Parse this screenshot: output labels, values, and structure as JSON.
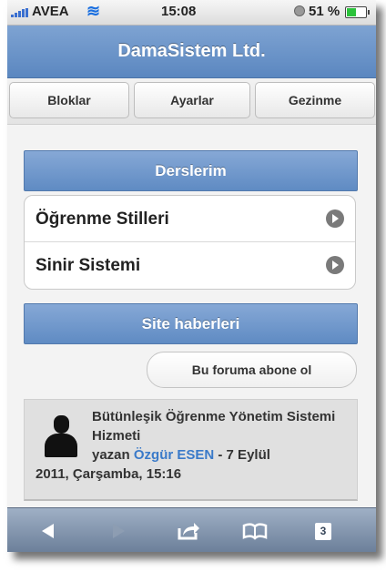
{
  "status_bar": {
    "carrier": "AVEA",
    "time": "15:08",
    "battery": "51 %",
    "battery_level": 0.51
  },
  "header": {
    "title": "DamaSistem Ltd."
  },
  "nav": {
    "bloklar": "Bloklar",
    "ayarlar": "Ayarlar",
    "gezinme": "Gezinme"
  },
  "courses": {
    "title": "Derslerim",
    "items": [
      {
        "label": "Öğrenme Stilleri"
      },
      {
        "label": "Sinir Sistemi"
      }
    ]
  },
  "news": {
    "title": "Site haberleri",
    "subscribe": "Bu foruma abone ol",
    "post": {
      "title": "Bütünleşik Öğrenme Yönetim Sistemi Hizmeti",
      "by": "yazan ",
      "author": "Özgür ESEN",
      "date_inline": " - 7 Eylül",
      "date_rest": "2011, Çarşamba, 15:16"
    }
  },
  "toolbar": {
    "tab_count": "3"
  },
  "colors": {
    "header": "#6b93c8",
    "section_bar": "#6f97cb",
    "author_link": "#3a7ac9",
    "toolbar": "#8396ae"
  }
}
